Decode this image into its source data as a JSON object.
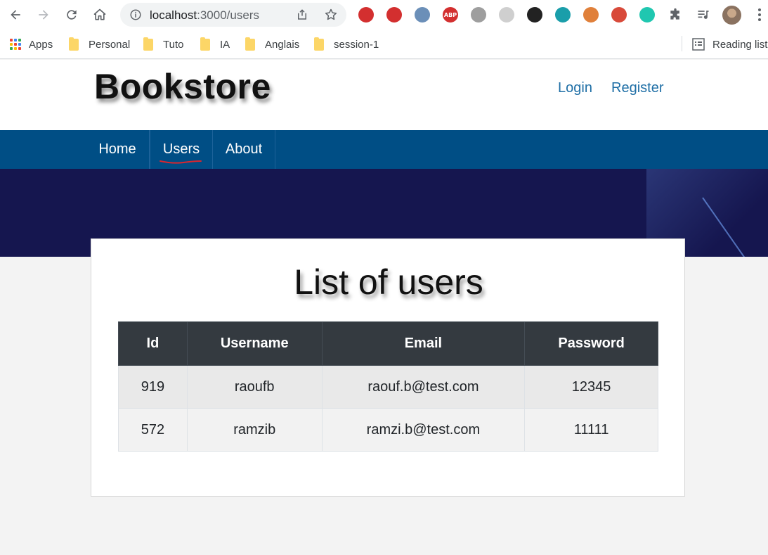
{
  "browser": {
    "url_host": "localhost",
    "url_path": ":3000/users",
    "bookmarks": [
      {
        "label": "Apps",
        "icon": "apps-grid-icon"
      },
      {
        "label": "Personal",
        "icon": "folder-icon"
      },
      {
        "label": "Tuto",
        "icon": "folder-icon"
      },
      {
        "label": "IA",
        "icon": "folder-icon"
      },
      {
        "label": "Anglais",
        "icon": "folder-icon"
      },
      {
        "label": "session-1",
        "icon": "folder-icon"
      }
    ],
    "reading_list": "Reading list",
    "extensions": [
      {
        "name": "ext-ladybug-icon",
        "text": "",
        "color": "#d32f2f"
      },
      {
        "name": "ext-hand-stop-icon",
        "text": "",
        "color": "#d32f2f"
      },
      {
        "name": "ext-opera-icon",
        "text": "",
        "color": "#6b8fb8"
      },
      {
        "name": "ext-abp-icon",
        "text": "ABP",
        "color": "#d32f2f"
      },
      {
        "name": "ext-link-icon",
        "text": "",
        "color": "#9e9e9e"
      },
      {
        "name": "ext-dotted-circle-icon",
        "text": "",
        "color": "#cfcfcf"
      },
      {
        "name": "ext-eyedropper-icon",
        "text": "",
        "color": "#222222"
      },
      {
        "name": "ext-square-teal-icon",
        "text": "",
        "color": "#1a9eaa"
      },
      {
        "name": "ext-ring-icon",
        "text": "",
        "color": "#e0803a"
      },
      {
        "name": "ext-paw-icon",
        "text": "",
        "color": "#d84a3a"
      },
      {
        "name": "ext-sparkle-icon",
        "text": "",
        "color": "#20c7b0"
      }
    ]
  },
  "site": {
    "brand": "Bookstore",
    "auth": {
      "login": "Login",
      "register": "Register"
    },
    "nav": [
      "Home",
      "Users",
      "About"
    ],
    "active_nav": "Users",
    "accent_color": "#004e85",
    "hero_color": "#15164f"
  },
  "users_page": {
    "title": "List of users",
    "columns": [
      "Id",
      "Username",
      "Email",
      "Password"
    ],
    "rows": [
      [
        "919",
        "raoufb",
        "raouf.b@test.com",
        "12345"
      ],
      [
        "572",
        "ramzib",
        "ramzi.b@test.com",
        "11111"
      ]
    ]
  }
}
